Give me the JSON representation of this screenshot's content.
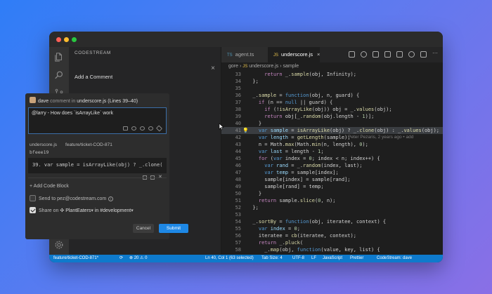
{
  "sidebar": {
    "header": "CODESTREAM",
    "title": "Add a Comment",
    "close_icon": "×"
  },
  "comment_card": {
    "author": "dave",
    "action": "comment in",
    "file_ref": "underscore.js (Lines 39–40)",
    "comment_text": "@larry - How does `isArrayLike` work",
    "file_name": "underscore.js",
    "branch": "feature/ticket-COD-871",
    "commit": "bfeee19",
    "code_line_number": "39.",
    "code_preview": "var sample = isArrayLike(obj) ? _.clone(",
    "add_code_block": "+ Add Code Block",
    "send_to": "Send to pez@codestream.com",
    "share_on": "Share on",
    "share_team": "PlantEaters",
    "share_channel": "in #development",
    "cancel_label": "Cancel",
    "submit_label": "Submit"
  },
  "tabs": [
    {
      "label": "agent.ts",
      "lang": "TS"
    },
    {
      "label": "underscore.js",
      "lang": "JS",
      "close": "×"
    }
  ],
  "breadcrumb": {
    "prefix": "gore",
    "sep": "›",
    "file": "underscore.js",
    "symbol": "sample"
  },
  "editor": {
    "blame": "Peter Pezaris, 2 years ago • add"
  },
  "statusbar": {
    "branch": "feature/ticket-COD-871*",
    "sync": "⟳",
    "problems": "⊗ 20 ⚠ 0",
    "position": "Ln 40, Col 1 (63 selected)",
    "tab_size": "Tab Size: 4",
    "encoding": "UTF-8",
    "eol": "LF",
    "language": "JavaScript",
    "formatter": "Prettier",
    "codestream": "CodeStream: dave"
  }
}
